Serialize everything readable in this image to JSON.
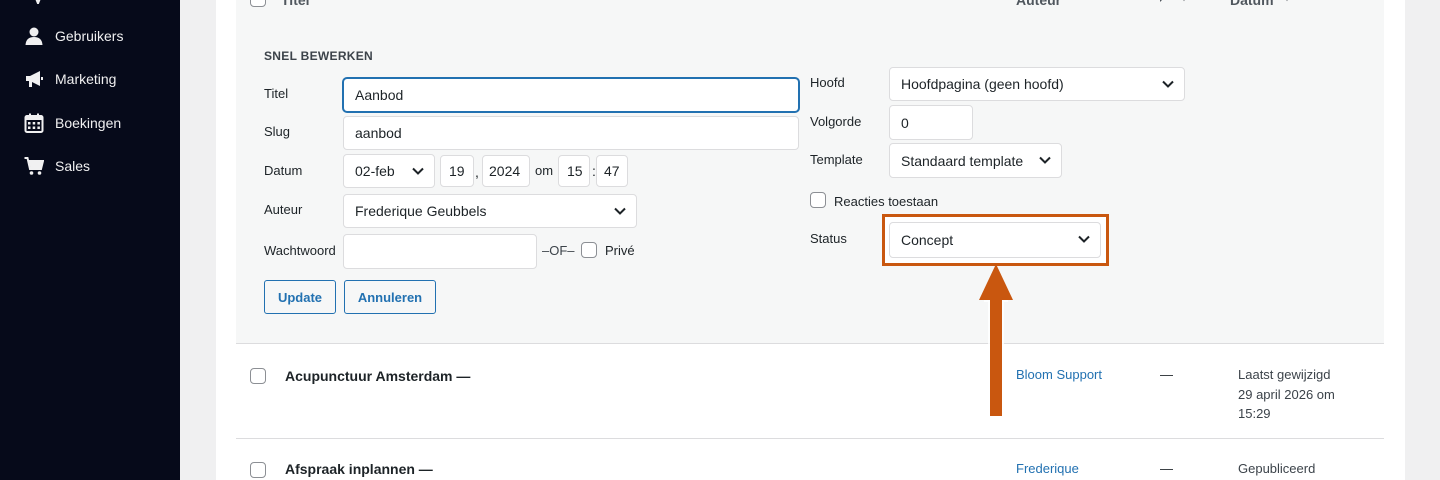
{
  "sidebar": {
    "items": [
      {
        "label": "Gebruikers",
        "icon": "user-icon"
      },
      {
        "label": "Marketing",
        "icon": "megaphone-icon"
      },
      {
        "label": "Boekingen",
        "icon": "calendar-icon"
      },
      {
        "label": "Sales",
        "icon": "cart-icon"
      }
    ]
  },
  "table_header": {
    "title": "Titel",
    "author": "Auteur",
    "date": "Datum"
  },
  "quick_edit": {
    "heading": "SNEL BEWERKEN",
    "title_label": "Titel",
    "title_value": "Aanbod",
    "slug_label": "Slug",
    "slug_value": "aanbod",
    "date_label": "Datum",
    "month": "02-feb",
    "day": "19",
    "year": "2024",
    "at": "om",
    "hour": "15",
    "minute": "47",
    "author_label": "Auteur",
    "author_value": "Frederique Geubbels",
    "password_label": "Wachtwoord",
    "password_value": "",
    "or_text": "–OF–",
    "private_label": "Privé",
    "update_button": "Update",
    "cancel_button": "Annuleren",
    "parent_label": "Hoofd",
    "parent_value": "Hoofdpagina (geen hoofd)",
    "order_label": "Volgorde",
    "order_value": "0",
    "template_label": "Template",
    "template_value": "Standaard template",
    "comments_label": "Reacties toestaan",
    "status_label": "Status",
    "status_value": "Concept"
  },
  "rows": [
    {
      "title": "Acupunctuur Amsterdam —",
      "author": "Bloom Support",
      "comments": "—",
      "date_status": "Laatst gewijzigd",
      "date_line1": "29 april 2026 om",
      "date_line2": "15:29"
    },
    {
      "title": "Afspraak inplannen —",
      "author": "Frederique",
      "comments": "—",
      "date_status": "Gepubliceerd"
    }
  ],
  "colors": {
    "accent": "#2271b1",
    "highlight": "#c9570f",
    "sidebar": "#060a1a"
  }
}
